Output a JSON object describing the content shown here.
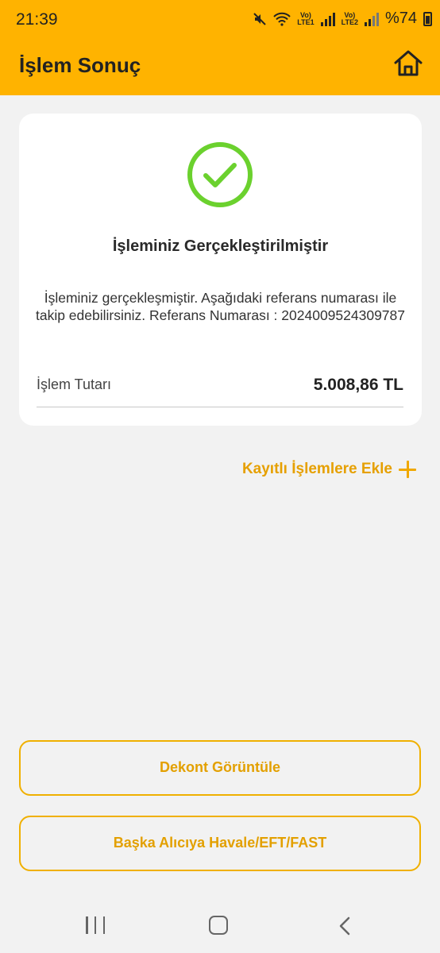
{
  "status_bar": {
    "time": "21:39",
    "lte1_top": "Vo)",
    "lte1_bottom": "LTE1",
    "lte2_top": "Vo)",
    "lte2_bottom": "LTE2",
    "battery": "%74",
    "icons": [
      "mute-icon",
      "wifi-icon",
      "signal-icon",
      "battery-icon"
    ]
  },
  "header": {
    "title": "İşlem Sonuç",
    "home_icon": "home-icon"
  },
  "result_card": {
    "icon": "check-circle-icon",
    "title": "İşleminiz Gerçekleştirilmiştir",
    "description": "İşleminiz gerçekleşmiştir. Aşağıdaki referans numarası ile takip edebilirsiniz. Referans Numarası : 2024009524309787",
    "amount_label": "İşlem Tutarı",
    "amount_value": "5.008,86 TL"
  },
  "add_saved": {
    "label": "Kayıtlı İşlemlere Ekle",
    "icon": "plus-icon"
  },
  "buttons": {
    "receipt": "Dekont Görüntüle",
    "new_transfer": "Başka Alıcıya Havale/EFT/FAST"
  },
  "colors": {
    "brand": "#ffb300",
    "accent_text": "#e3a000",
    "success": "#6bd12e"
  }
}
